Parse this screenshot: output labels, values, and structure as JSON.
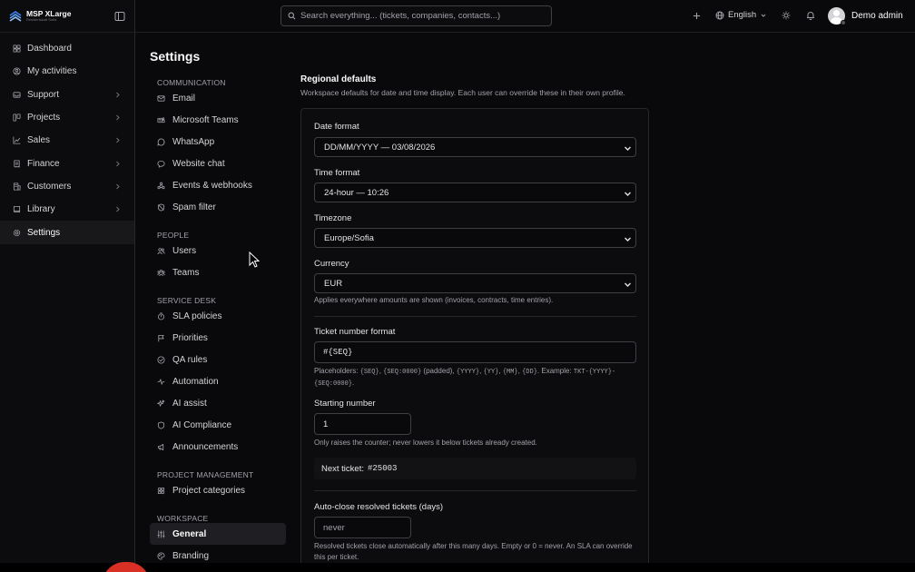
{
  "brand": {
    "name": "MSP XLarge",
    "subtitle": "Residenskatt Sofia"
  },
  "sidebar": {
    "items": [
      {
        "label": "Dashboard",
        "icon": "dashboard-icon",
        "chevron": false,
        "active": false
      },
      {
        "label": "My activities",
        "icon": "user-circle-icon",
        "chevron": false,
        "active": false
      },
      {
        "label": "Support",
        "icon": "inbox-icon",
        "chevron": true,
        "active": false
      },
      {
        "label": "Projects",
        "icon": "projects-icon",
        "chevron": true,
        "active": false
      },
      {
        "label": "Sales",
        "icon": "chart-icon",
        "chevron": true,
        "active": false
      },
      {
        "label": "Finance",
        "icon": "receipt-icon",
        "chevron": true,
        "active": false
      },
      {
        "label": "Customers",
        "icon": "building-icon",
        "chevron": true,
        "active": false
      },
      {
        "label": "Library",
        "icon": "book-icon",
        "chevron": true,
        "active": false
      },
      {
        "label": "Settings",
        "icon": "gear-icon",
        "chevron": false,
        "active": true
      }
    ]
  },
  "topbar": {
    "search_placeholder": "Search everything... (tickets, companies, contacts...)",
    "language": "English",
    "user_name": "Demo admin"
  },
  "page": {
    "title": "Settings"
  },
  "subnav": {
    "communication": {
      "heading": "COMMUNICATION",
      "items": [
        "Email",
        "Microsoft Teams",
        "WhatsApp",
        "Website chat",
        "Events & webhooks",
        "Spam filter"
      ]
    },
    "people": {
      "heading": "PEOPLE",
      "items": [
        "Users",
        "Teams"
      ]
    },
    "service_desk": {
      "heading": "SERVICE DESK",
      "items": [
        "SLA policies",
        "Priorities",
        "QA rules",
        "Automation",
        "AI assist",
        "AI Compliance",
        "Announcements"
      ]
    },
    "project_management": {
      "heading": "PROJECT MANAGEMENT",
      "items": [
        "Project categories"
      ]
    },
    "workspace": {
      "heading": "WORKSPACE",
      "items": [
        "General",
        "Branding"
      ],
      "active": "General"
    }
  },
  "regional": {
    "title": "Regional defaults",
    "description": "Workspace defaults for date and time display. Each user can override these in their own profile.",
    "date_format": {
      "label": "Date format",
      "value": "DD/MM/YYYY — 03/08/2026"
    },
    "time_format": {
      "label": "Time format",
      "value": "24-hour — 10:26"
    },
    "timezone": {
      "label": "Timezone",
      "value": "Europe/Sofia"
    },
    "currency": {
      "label": "Currency",
      "value": "EUR",
      "help": "Applies everywhere amounts are shown (invoices, contracts, time entries)."
    },
    "ticket_format": {
      "label": "Ticket number format",
      "value": "#{SEQ}",
      "help_prefix": "Placeholders: ",
      "ph_seq": "{SEQ}",
      "sep1": ", ",
      "ph_seq_pad": "{SEQ:0000}",
      "padded": " (padded), ",
      "ph_yyyy": "{YYYY}",
      "sep2": ", ",
      "ph_yy": "{YY}",
      "sep3": ", ",
      "ph_mm": "{MM}",
      "sep4": ", ",
      "ph_dd": "{DD}",
      "example_label": ". Example: ",
      "example_value": "TKT-{YYYY}-{SEQ:0000}",
      "end": "."
    },
    "starting_number": {
      "label": "Starting number",
      "value": "1",
      "help": "Only raises the counter; never lowers it below tickets already created."
    },
    "next_ticket": {
      "label": "Next ticket:",
      "value": "#25003"
    },
    "auto_close": {
      "label": "Auto-close resolved tickets (days)",
      "placeholder": "never",
      "help": "Resolved tickets close automatically after this many days. Empty or 0 = never. An SLA can override this per ticket."
    }
  }
}
